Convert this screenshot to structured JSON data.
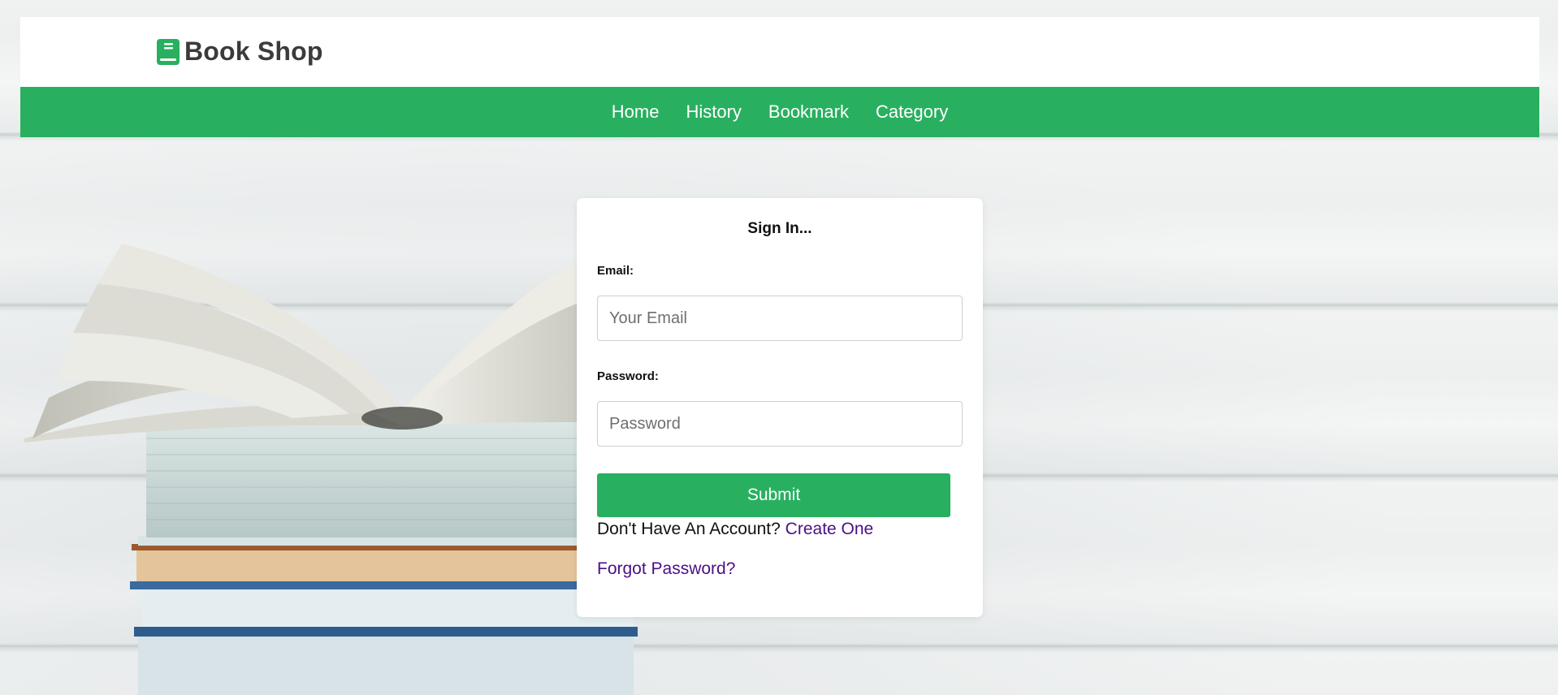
{
  "brand": {
    "name": "Book Shop",
    "icon": "book-icon",
    "color": "#28b060"
  },
  "nav": {
    "items": [
      {
        "label": "Home"
      },
      {
        "label": "History"
      },
      {
        "label": "Bookmark"
      },
      {
        "label": "Category"
      }
    ],
    "background": "#28b060"
  },
  "signin": {
    "title": "Sign In...",
    "email_label": "Email:",
    "email_placeholder": "Your Email",
    "email_value": "",
    "password_label": "Password:",
    "password_placeholder": "Password",
    "password_value": "",
    "submit_label": "Submit",
    "account_prompt": "Don't Have An Account?",
    "create_link": "Create One",
    "forgot_link": "Forgot Password?"
  },
  "colors": {
    "accent": "#28b060",
    "link": "#4b0f87"
  }
}
